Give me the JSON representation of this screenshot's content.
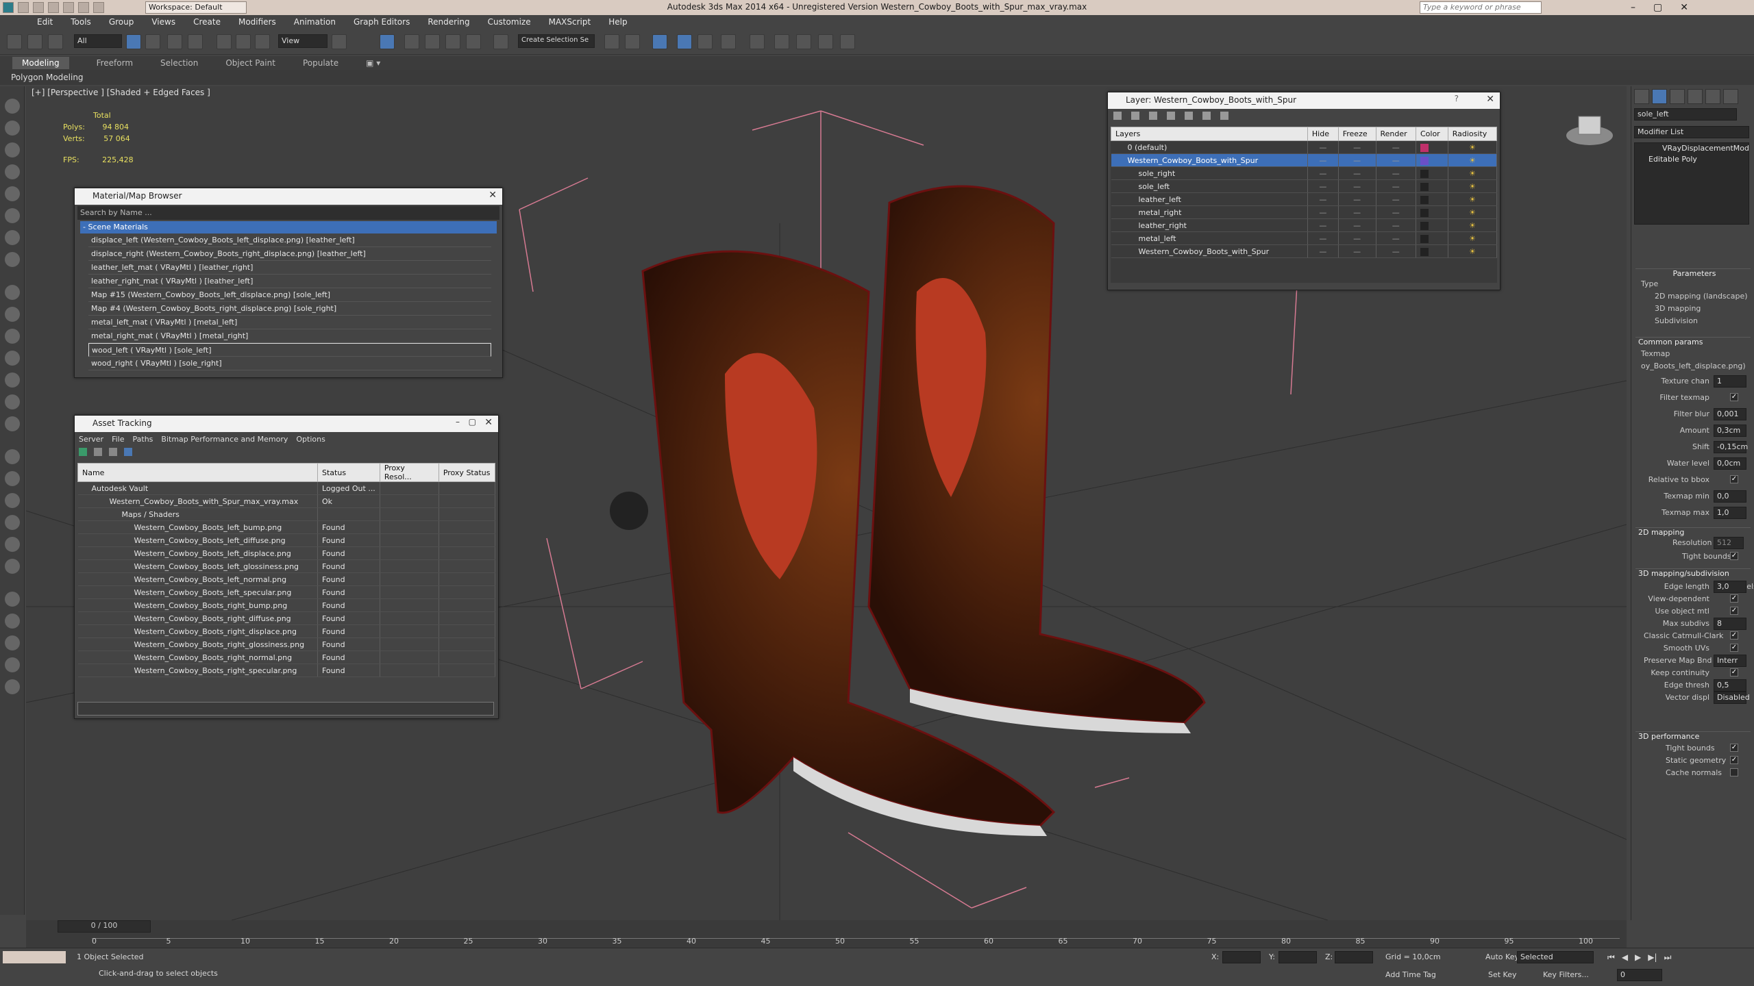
{
  "app": {
    "title": "Autodesk 3ds Max  2014 x64  -  Unregistered Version   Western_Cowboy_Boots_with_Spur_max_vray.max",
    "workspace": "Workspace: Default",
    "search_placeholder": "Type a keyword or phrase"
  },
  "menu": [
    "Edit",
    "Tools",
    "Group",
    "Views",
    "Create",
    "Modifiers",
    "Animation",
    "Graph Editors",
    "Rendering",
    "Customize",
    "MAXScript",
    "Help"
  ],
  "toolbar": {
    "filter": "All",
    "refcoord": "View",
    "named_selection": "Create Selection Se"
  },
  "ribbon": {
    "tabs": [
      "Modeling",
      "Freeform",
      "Selection",
      "Object Paint",
      "Populate"
    ],
    "active": "Modeling",
    "sub": "Polygon Modeling"
  },
  "viewport": {
    "label": "[+] [Perspective ] [Shaded + Edged Faces ]",
    "stats": {
      "total": "Total",
      "polys_label": "Polys:",
      "polys": "94 804",
      "verts_label": "Verts:",
      "verts": "57 064",
      "fps_label": "FPS:",
      "fps": "225,428"
    }
  },
  "material_browser": {
    "title": "Material/Map Browser",
    "search": "Search by Name ...",
    "section": "- Scene Materials",
    "items": [
      "displace_left (Western_Cowboy_Boots_left_displace.png) [leather_left]",
      "displace_right (Western_Cowboy_Boots_right_displace.png) [leather_left]",
      "leather_left_mat  ( VRayMtl ) [leather_right]",
      "leather_right_mat  ( VRayMtl ) [leather_left]",
      "Map #15 (Western_Cowboy_Boots_left_displace.png) [sole_left]",
      "Map #4 (Western_Cowboy_Boots_right_displace.png) [sole_right]",
      "metal_left_mat  ( VRayMtl ) [metal_left]",
      "metal_right_mat  ( VRayMtl ) [metal_right]",
      "wood_left  ( VRayMtl ) [sole_left]",
      "wood_right  ( VRayMtl ) [sole_right]"
    ]
  },
  "asset_tracking": {
    "title": "Asset Tracking",
    "menu": [
      "Server",
      "File",
      "Paths",
      "Bitmap Performance and Memory",
      "Options"
    ],
    "columns": [
      "Name",
      "Status",
      "Proxy Resol...",
      "Proxy Status"
    ],
    "rows": [
      [
        "Autodesk Vault",
        "Logged Out ..."
      ],
      [
        "Western_Cowboy_Boots_with_Spur_max_vray.max",
        "Ok"
      ],
      [
        "Maps / Shaders",
        ""
      ],
      [
        "Western_Cowboy_Boots_left_bump.png",
        "Found"
      ],
      [
        "Western_Cowboy_Boots_left_diffuse.png",
        "Found"
      ],
      [
        "Western_Cowboy_Boots_left_displace.png",
        "Found"
      ],
      [
        "Western_Cowboy_Boots_left_glossiness.png",
        "Found"
      ],
      [
        "Western_Cowboy_Boots_left_normal.png",
        "Found"
      ],
      [
        "Western_Cowboy_Boots_left_specular.png",
        "Found"
      ],
      [
        "Western_Cowboy_Boots_right_bump.png",
        "Found"
      ],
      [
        "Western_Cowboy_Boots_right_diffuse.png",
        "Found"
      ],
      [
        "Western_Cowboy_Boots_right_displace.png",
        "Found"
      ],
      [
        "Western_Cowboy_Boots_right_glossiness.png",
        "Found"
      ],
      [
        "Western_Cowboy_Boots_right_normal.png",
        "Found"
      ],
      [
        "Western_Cowboy_Boots_right_specular.png",
        "Found"
      ]
    ]
  },
  "layer_dialog": {
    "title": "Layer: Western_Cowboy_Boots_with_Spur",
    "columns": [
      "Layers",
      "Hide",
      "Freeze",
      "Render",
      "Color",
      "Radiosity"
    ],
    "rows": [
      "0 (default)",
      "Western_Cowboy_Boots_with_Spur",
      "sole_right",
      "sole_left",
      "leather_left",
      "metal_right",
      "leather_right",
      "metal_left",
      "Western_Cowboy_Boots_with_Spur"
    ],
    "colors": [
      "#c0306a",
      "#6a50c8",
      "#222222",
      "#222222",
      "#222222",
      "#222222",
      "#222222",
      "#222222",
      "#222222"
    ]
  },
  "modifier_panel": {
    "object_name": "sole_left",
    "modifier_list": "Modifier List",
    "stack": [
      "VRayDisplacementMod",
      "Editable Poly"
    ],
    "params_title": "Parameters",
    "type_label": "Type",
    "types": [
      "2D mapping (landscape)",
      "3D mapping",
      "Subdivision"
    ],
    "common": "Common params",
    "texmap_label": "Texmap",
    "texmap": "oy_Boots_left_displace.png)",
    "fields": [
      [
        "Texture chan",
        "1"
      ],
      [
        "Filter texmap",
        ""
      ],
      [
        "Filter blur",
        "0,001"
      ],
      [
        "Amount",
        "0,3cm"
      ],
      [
        "Shift",
        "-0,15cm"
      ],
      [
        "Water level",
        "0,0cm"
      ],
      [
        "Relative to bbox",
        ""
      ],
      [
        "Texmap min",
        "0,0"
      ],
      [
        "Texmap max",
        "1,0"
      ]
    ],
    "s2d": "2D mapping",
    "resolution_label": "Resolution",
    "resolution": "512",
    "tight": "Tight bounds",
    "s3d": "3D mapping/subdivision",
    "fields3d": [
      [
        "Edge length",
        "3,0"
      ],
      [
        "View-dependent",
        ""
      ],
      [
        "Use object mtl",
        ""
      ],
      [
        "Max subdivs",
        "8"
      ],
      [
        "Classic Catmull-Clark",
        ""
      ],
      [
        "Smooth UVs",
        ""
      ],
      [
        "Preserve Map Bnd",
        "Interr"
      ],
      [
        "Keep continuity",
        ""
      ],
      [
        "Edge thresh",
        "0,5"
      ],
      [
        "Vector displ",
        "Disabled"
      ]
    ],
    "pixels": "pixels",
    "perf": "3D performance",
    "perf_items": [
      "Tight bounds",
      "Static geometry",
      "Cache normals"
    ]
  },
  "timeline": {
    "slider": "0 / 100",
    "ticks": [
      "0",
      "5",
      "10",
      "15",
      "20",
      "25",
      "30",
      "35",
      "40",
      "45",
      "50",
      "55",
      "60",
      "65",
      "70",
      "75",
      "80",
      "85",
      "90",
      "95",
      "100"
    ]
  },
  "status": {
    "selected": "1 Object Selected",
    "prompt": "Click-and-drag to select objects",
    "x": "X:",
    "y": "Y:",
    "z": "Z:",
    "grid": "Grid = 10,0cm",
    "autokey": "Auto Key",
    "autokey_value": "Selected",
    "setkey": "Set Key",
    "keyfilters": "Key Filters...",
    "addtimetag": "Add Time Tag",
    "frame": "0"
  }
}
